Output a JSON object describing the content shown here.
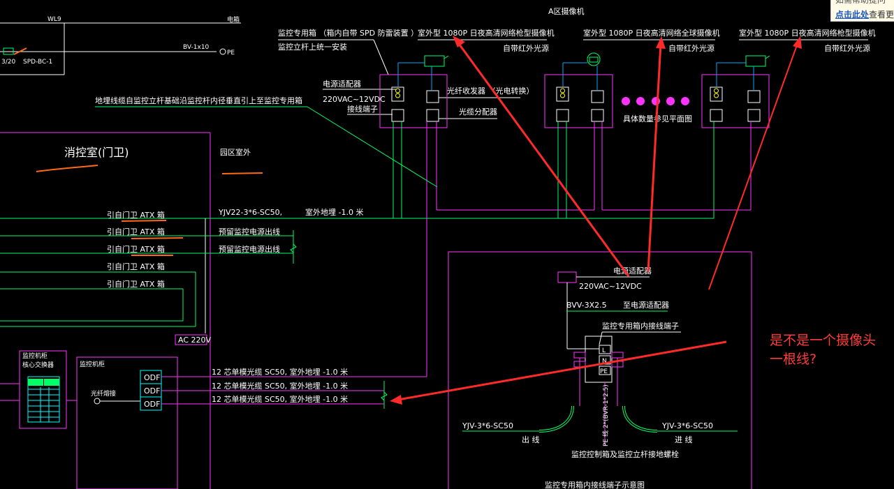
{
  "title": "A区摄像机",
  "top_labels": {
    "wl": "WL9",
    "wl_r": "电箱",
    "bv": "BV-1x10",
    "pe": "PE",
    "spd": "SPD-BC-1",
    "v": "3/20"
  },
  "cameras": [
    {
      "type": "室外型 1080P 日夜高清网络枪型摄像机",
      "light": "自带红外光源"
    },
    {
      "type": "室外型 1080P 日夜高清网络全球摄像机",
      "light": "自带红外光源"
    },
    {
      "type": "室外型 1080P 日夜高清网络枪型摄像机",
      "light": "自带红外光源"
    }
  ],
  "box_labels": {
    "monitor_box": "监控专用箱 （箱内自带 SPD 防雷装置 ）",
    "pole_mount": "监控立杆上统一安装",
    "power_adapter": "电源适配器",
    "voltage": "220VAC~12VDC",
    "terminal": "接线端子",
    "fiber_transceiver": "光纤收发器 （光电转换）",
    "fiber_splitter": "光缆分配器",
    "detail_note": "具体数量参见平面图"
  },
  "ground_note": "地埋线缆自监控立杆基础沿监控杆内径垂直引上至监控专用箱",
  "rooms": {
    "guard": "消控室(门卫)",
    "outdoor": "园区室外"
  },
  "feeds": [
    {
      "from": "引自门卫 ATX 箱",
      "cable": "YJV22-3*6-SC50,",
      "lay": "室外地埋 -1.0 米"
    },
    {
      "from": "引自门卫 ATX 箱",
      "cable": "预留监控电源出线",
      "lay": ""
    },
    {
      "from": "引自门卫 ATX 箱",
      "cable": "预留监控电源出线",
      "lay": ""
    },
    {
      "from": "引自门卫 ATX 箱",
      "cable": "",
      "lay": ""
    },
    {
      "from": "引自门卫 ATX 箱",
      "cable": "",
      "lay": ""
    }
  ],
  "ac": "AC 220V",
  "left_panel": {
    "title1": "监控机柜",
    "title2": "核心交换器",
    "cab": "监控机柜",
    "fiber": "光纤熔接",
    "odf": [
      "ODF",
      "ODF",
      "ODF"
    ]
  },
  "fiber_lines": [
    "12 芯单模光缆 SC50, 室外地埋 -1.0 米",
    "12 芯单模光缆 SC50, 室外地埋 -1.0 米",
    "12 芯单模光缆 SC50, 室外地埋 -1.0 米"
  ],
  "detail": {
    "power_adapter": "电源适配器",
    "voltage": "220VAC~12VDC",
    "bvv": "BVV-3X2.5",
    "to_adapter": "至电源适配器",
    "terminal": "监控专用箱内接线端子",
    "tb": [
      "L",
      "N",
      "PE"
    ],
    "out_cable": "YJV-3*6-SC50",
    "in_cable": "YJV-3*6-SC50",
    "out": "出 线",
    "in": "进 线",
    "pe": "PE 线 2*(BVR-1*2.5)",
    "ground": "监控控制箱及监控立杆接地螺栓",
    "caption": "监控专用箱内接线端子示意图"
  },
  "annotation": [
    "是不是一个摄像头",
    "一根线?"
  ],
  "tooltip": {
    "line1": "如需帮助提问",
    "link": "点击此处",
    "rest": "查看更"
  }
}
